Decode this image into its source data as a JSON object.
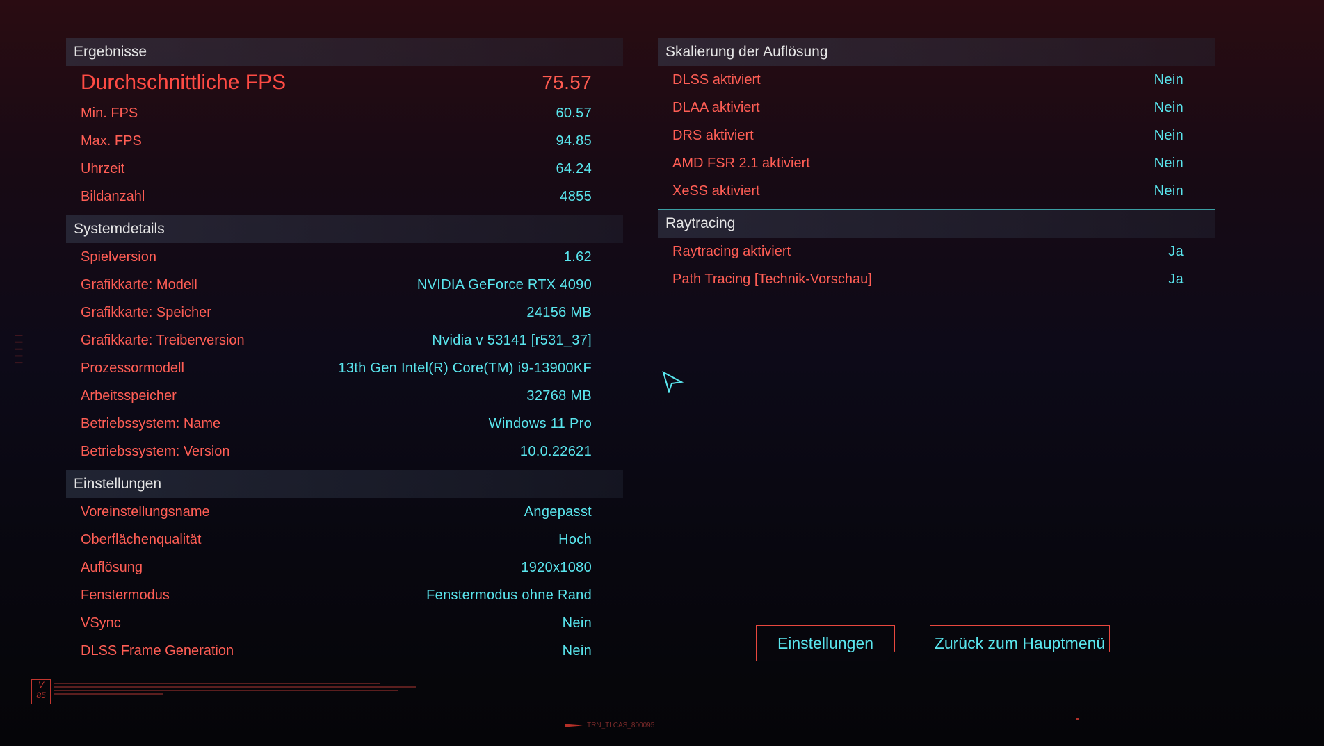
{
  "results": {
    "title": "Ergebnisse",
    "avg_label": "Durchschnittliche FPS",
    "avg_value": "75.57",
    "rows": [
      {
        "label": "Min. FPS",
        "value": "60.57"
      },
      {
        "label": "Max. FPS",
        "value": "94.85"
      },
      {
        "label": "Uhrzeit",
        "value": "64.24"
      },
      {
        "label": "Bildanzahl",
        "value": "4855"
      }
    ]
  },
  "system": {
    "title": "Systemdetails",
    "rows": [
      {
        "label": "Spielversion",
        "value": "1.62"
      },
      {
        "label": "Grafikkarte: Modell",
        "value": "NVIDIA GeForce RTX 4090"
      },
      {
        "label": "Grafikkarte: Speicher",
        "value": "24156 MB"
      },
      {
        "label": "Grafikkarte: Treiberversion",
        "value": "Nvidia v 53141 [r531_37]"
      },
      {
        "label": "Prozessormodell",
        "value": "13th Gen Intel(R) Core(TM) i9-13900KF"
      },
      {
        "label": "Arbeitsspeicher",
        "value": "32768 MB"
      },
      {
        "label": "Betriebssystem: Name",
        "value": "Windows 11 Pro"
      },
      {
        "label": "Betriebssystem: Version",
        "value": "10.0.22621"
      }
    ]
  },
  "settings": {
    "title": "Einstellungen",
    "rows": [
      {
        "label": "Voreinstellungsname",
        "value": "Angepasst"
      },
      {
        "label": "Oberflächenqualität",
        "value": "Hoch"
      },
      {
        "label": "Auflösung",
        "value": "1920x1080"
      },
      {
        "label": "Fenstermodus",
        "value": "Fenstermodus ohne Rand"
      },
      {
        "label": "VSync",
        "value": "Nein"
      },
      {
        "label": "DLSS Frame Generation",
        "value": "Nein"
      }
    ]
  },
  "scaling": {
    "title": "Skalierung der Auflösung",
    "rows": [
      {
        "label": "DLSS aktiviert",
        "value": "Nein"
      },
      {
        "label": "DLAA aktiviert",
        "value": "Nein"
      },
      {
        "label": "DRS aktiviert",
        "value": "Nein"
      },
      {
        "label": "AMD FSR 2.1 aktiviert",
        "value": "Nein"
      },
      {
        "label": "XeSS aktiviert",
        "value": "Nein"
      }
    ]
  },
  "raytracing": {
    "title": "Raytracing",
    "rows": [
      {
        "label": "Raytracing aktiviert",
        "value": "Ja"
      },
      {
        "label": "Path Tracing [Technik-Vorschau]",
        "value": "Ja"
      }
    ]
  },
  "buttons": {
    "settings": "Einstellungen",
    "main_menu": "Zurück zum Hauptmenü"
  },
  "decor": {
    "badge_top": "V",
    "badge_bottom": "85",
    "bottom_tag": "TRN_TLCAS_800095"
  },
  "colors": {
    "label_red": "#ff5e55",
    "value_cyan": "#5ae6ee",
    "divider_teal": "#3a9ea3"
  }
}
